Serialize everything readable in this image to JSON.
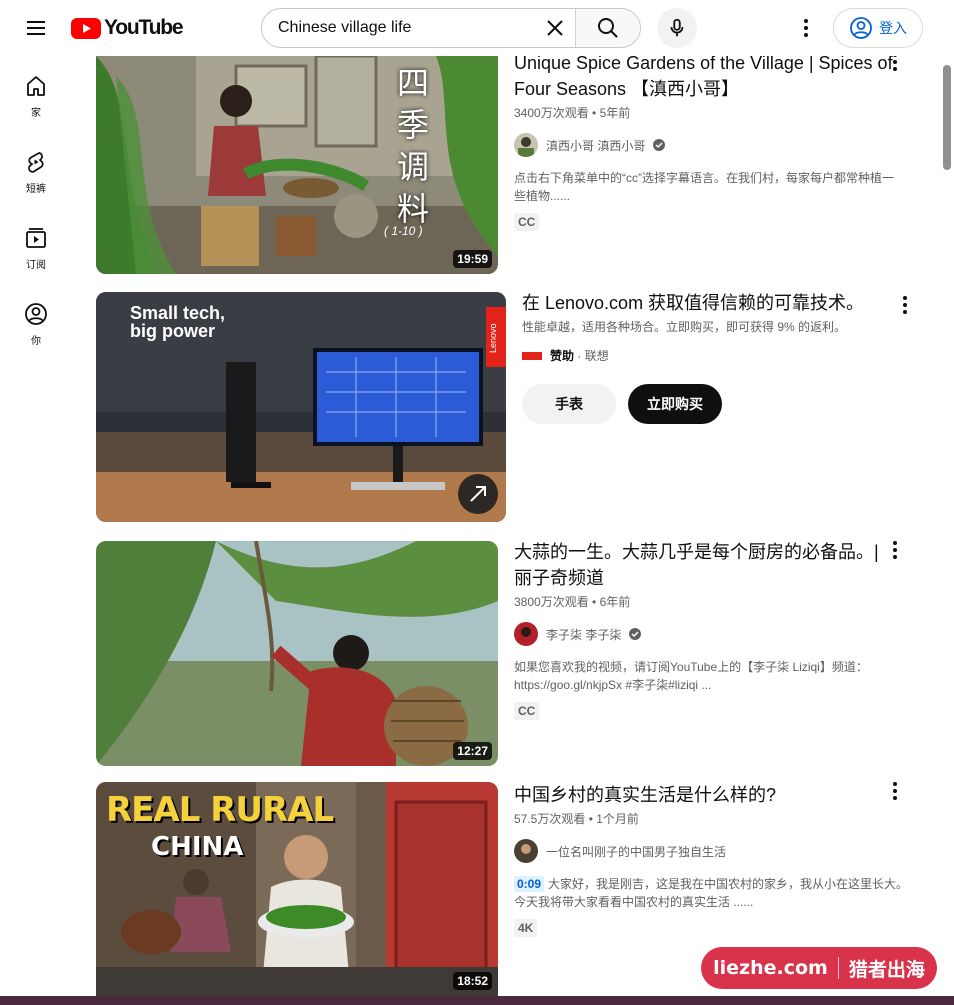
{
  "header": {
    "logo_text": "YouTube",
    "search": {
      "value": "Chinese village life"
    },
    "signin_label": "登入"
  },
  "guide": [
    {
      "label": "家",
      "icon": "home-icon"
    },
    {
      "label": "短裤",
      "icon": "shorts-icon"
    },
    {
      "label": "订阅",
      "icon": "subscriptions-icon"
    },
    {
      "label": "你",
      "icon": "you-icon"
    }
  ],
  "results": [
    {
      "title": "Unique Spice Gardens of the Village | Spices of Four Seasons 【滇西小哥】",
      "views": "3400万次观看",
      "age": "5年前",
      "channel": "滇西小哥 滇西小哥",
      "verified": true,
      "description": "点击右下角菜单中的“cc”选择字幕语言。在我们村，每家每户都常种植一些植物......",
      "badge": "CC",
      "duration": "19:59",
      "overlay_text": [
        "四",
        "季",
        "调",
        "料",
        "( 1-10 )"
      ]
    },
    {
      "title": "大蒜的一生。大蒜几乎是每个厨房的必备品。| 丽子奇频道",
      "views": "3800万次观看",
      "age": "6年前",
      "channel": "李子柒 李子柒",
      "verified": true,
      "description": "如果您喜欢我的视频，请订阅YouTube上的【李子柒 Liziqi】频道：https://goo.gl/nkjpSx #李子柒#liziqi ...",
      "badge": "CC",
      "duration": "12:27"
    },
    {
      "title": "中国乡村的真实生活是什么样的?",
      "views": "57.5万次观看",
      "age": "1个月前",
      "channel": "一位名叫刚子的中国男子独自生活",
      "verified": false,
      "timestamp": "0:09",
      "description": "大家好，我是刚吉，这是我在中国农村的家乡，我从小在这里长大。今天我将带大家看看中国农村的真实生活 ......",
      "badge": "4K",
      "duration": "18:52",
      "overlay_text": [
        "REAL RURAL",
        "CHINA"
      ]
    }
  ],
  "ad": {
    "title": "在 Lenovo.com 获取值得信赖的可靠技术。",
    "description": "性能卓越，适用各种场合。立即购买，即可获得 9% 的返利。",
    "sponsor_label": "赞助",
    "advertiser": "联想",
    "button_secondary": "手表",
    "button_primary": "立即购买",
    "image_text": [
      "Small tech,",
      "big power"
    ],
    "brand_text": "Lenovo"
  },
  "watermark": {
    "left": "liezhe.com",
    "right": "猎者出海"
  },
  "colors": {
    "brand_red": "#ff0000",
    "link_blue": "#065fd4",
    "watermark_red": "#d9334c"
  }
}
